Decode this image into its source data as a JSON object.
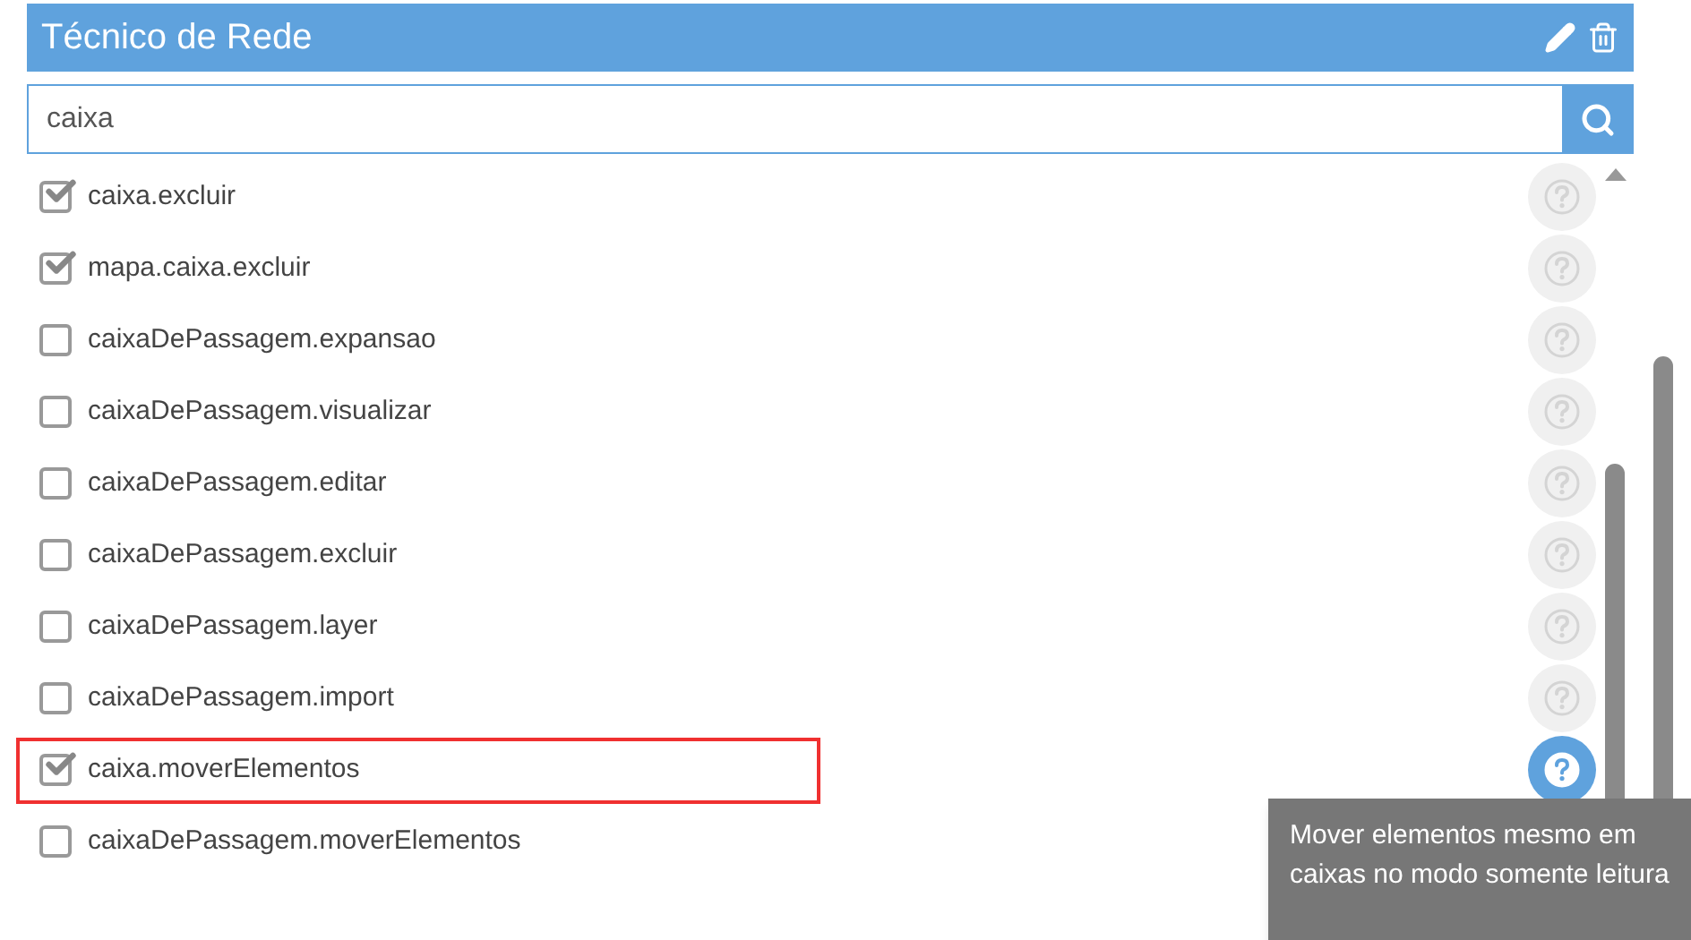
{
  "header": {
    "title": "Técnico de Rede"
  },
  "search": {
    "value": "caixa"
  },
  "permissions": [
    {
      "label": "caixa.excluir",
      "checked": true,
      "highlighted": false,
      "help_active": false
    },
    {
      "label": "mapa.caixa.excluir",
      "checked": true,
      "highlighted": false,
      "help_active": false
    },
    {
      "label": "caixaDePassagem.expansao",
      "checked": false,
      "highlighted": false,
      "help_active": false
    },
    {
      "label": "caixaDePassagem.visualizar",
      "checked": false,
      "highlighted": false,
      "help_active": false
    },
    {
      "label": "caixaDePassagem.editar",
      "checked": false,
      "highlighted": false,
      "help_active": false
    },
    {
      "label": "caixaDePassagem.excluir",
      "checked": false,
      "highlighted": false,
      "help_active": false
    },
    {
      "label": "caixaDePassagem.layer",
      "checked": false,
      "highlighted": false,
      "help_active": false
    },
    {
      "label": "caixaDePassagem.import",
      "checked": false,
      "highlighted": false,
      "help_active": false
    },
    {
      "label": "caixa.moverElementos",
      "checked": true,
      "highlighted": true,
      "help_active": true
    },
    {
      "label": "caixaDePassagem.moverElementos",
      "checked": false,
      "highlighted": false
    }
  ],
  "tooltip": {
    "text": "Mover elementos mesmo em caixas no modo somente leitura"
  }
}
